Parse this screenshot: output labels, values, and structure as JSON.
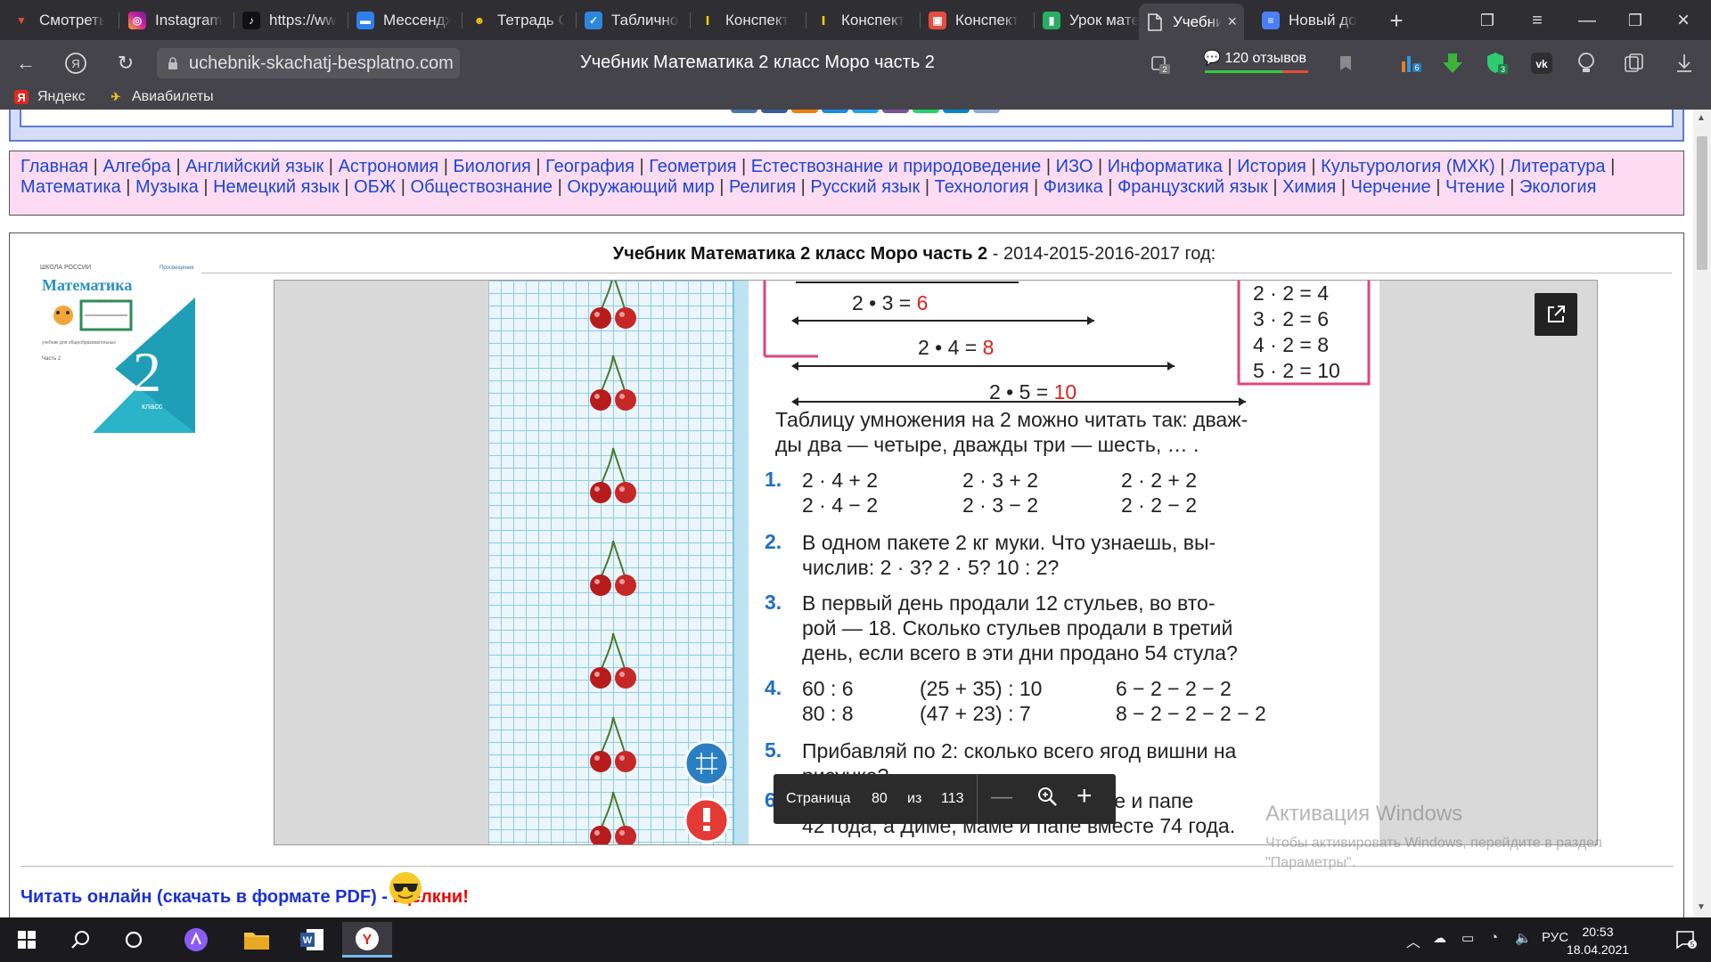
{
  "browser": {
    "tabs": [
      {
        "label": "Смотреть",
        "icon": "red-play-icon",
        "color": "#c0392b",
        "left": 0
      },
      {
        "label": "Instagram",
        "icon": "instagram-icon",
        "color": "#d6249f"
      },
      {
        "label": "https://ww",
        "icon": "tiktok-icon",
        "color": "#111111"
      },
      {
        "label": "Мессендж",
        "icon": "messenger-icon",
        "color": "#2f80ed"
      },
      {
        "label": "Тетрадь С",
        "icon": "notebook-icon",
        "color": "#f1c40f"
      },
      {
        "label": "Табличное",
        "icon": "checkmark-icon",
        "color": "#2e86de"
      },
      {
        "label": "Конспект",
        "icon": "yellow-i-icon",
        "color": "#f7d000"
      },
      {
        "label": "Конспект",
        "icon": "yellow-i-icon",
        "color": "#f7d000"
      },
      {
        "label": "Конспект",
        "icon": "red-box-icon",
        "color": "#e74c3c"
      },
      {
        "label": "Урок мате",
        "icon": "green-doc-icon",
        "color": "#27ae60"
      }
    ],
    "active_tab": {
      "label": "Учебни",
      "icon": "document-icon"
    },
    "extra_tab": {
      "label": "Новый до",
      "icon": "google-docs-icon",
      "color": "#4a7ff7"
    },
    "url": "uchebnik-skachatj-besplatno.com",
    "page_title": "Учебник Математика 2 класс Моро часть 2",
    "reviews_label": "120 отзывов",
    "badge_tabs": "2",
    "badge_ext1": "6",
    "badge_ext2": "3",
    "bookmarks": [
      {
        "label": "Яндекс",
        "icon": "yandex-icon"
      },
      {
        "label": "Авиабилеты",
        "icon": "plane-icon"
      }
    ]
  },
  "site": {
    "subjects": [
      "Главная",
      "Алгебра",
      "Английский язык",
      "Астрономия",
      "Биология",
      "География",
      "Геометрия",
      "Естествознание и природоведение",
      "ИЗО",
      "Информатика",
      "История",
      "Культурология (МХК)",
      "Литература",
      "Математика",
      "Музыка",
      "Немецкий язык",
      "ОБЖ",
      "Обществознание",
      "Окружающий мир",
      "Религия",
      "Русский язык",
      "Технология",
      "Физика",
      "Французский язык",
      "Химия",
      "Черчение",
      "Чтение",
      "Экология"
    ],
    "heading_bold": "Учебник Математика 2 класс Моро часть 2",
    "heading_rest": " - 2014-2015-2016-2017 год:",
    "cover": {
      "series": "ШКОЛА РОССИИ",
      "publisher": "Просвещение",
      "title": "Математика",
      "grade": "2",
      "grade_word": "класс",
      "part": "Часть 2"
    },
    "read_link_blue": "Читать онлайн (скачать в формате PDF) - ",
    "read_link_red": "Щелкни!"
  },
  "pdf_page": {
    "eq1": {
      "lhs": "2 • 3 =",
      "ans": "6"
    },
    "eq2": {
      "lhs": "2 • 4 =",
      "ans": "8"
    },
    "eq3": {
      "lhs": "2 • 5 =",
      "ans": "10"
    },
    "table_rows": [
      "2 · 2 = 4",
      "3 · 2 = 6",
      "4 · 2 = 8",
      "5 · 2 = 10"
    ],
    "intro_1": "Таблицу умножения на 2 можно читать так: дваж-",
    "intro_2": "ды два — четыре, дважды три — шесть, … .",
    "task1": {
      "num": "1.",
      "cols": [
        [
          "2 · 4 + 2",
          "2 · 4 − 2"
        ],
        [
          "2 · 3 + 2",
          "2 · 3 − 2"
        ],
        [
          "2 · 2 + 2",
          "2 · 2 − 2"
        ]
      ]
    },
    "task2": {
      "num": "2.",
      "line1": "В одном пакете 2 кг муки. Что узнаешь, вы-",
      "line2": "числив: 2 · 3? 2 · 5? 10 : 2?"
    },
    "task3": {
      "num": "3.",
      "line1": "В первый день продали 12 стульев, во вто-",
      "line2": "рой — 18. Сколько стульев продали в третий",
      "line3": "день, если всего в эти дни продано 54 стула?"
    },
    "task4": {
      "num": "4.",
      "cols": [
        [
          "60 : 6",
          "80 : 8"
        ],
        [
          "(25 + 35) : 10",
          "(47 + 23) : 7"
        ],
        [
          "6 − 2 − 2 − 2",
          "8 − 2 − 2 − 2 − 2"
        ]
      ]
    },
    "task5": {
      "num": "5.",
      "line1": "Прибавляй по 2: сколько всего ягод вишни на",
      "line2": "рисунке?"
    },
    "task6": {
      "num": "6.",
      "line1": "Диме и маме вместе 40 лет, Диме и папе",
      "line2": "42 года, а Диме, маме и папе вместе 74 года."
    }
  },
  "pdf_controls": {
    "page_label": "Страница",
    "page": "80",
    "of_label": "из",
    "total": "113"
  },
  "watermark": {
    "title": "Активация Windows",
    "text": "Чтобы активировать Windows, перейдите в раздел \"Параметры\"."
  },
  "taskbar": {
    "lang": "РУС",
    "time": "20:53",
    "date": "18.04.2021",
    "notifications": "5"
  },
  "colors": {
    "answer_red": "#e02020",
    "task_blue": "#1f6fc5",
    "frame_pink": "#e0457b"
  }
}
